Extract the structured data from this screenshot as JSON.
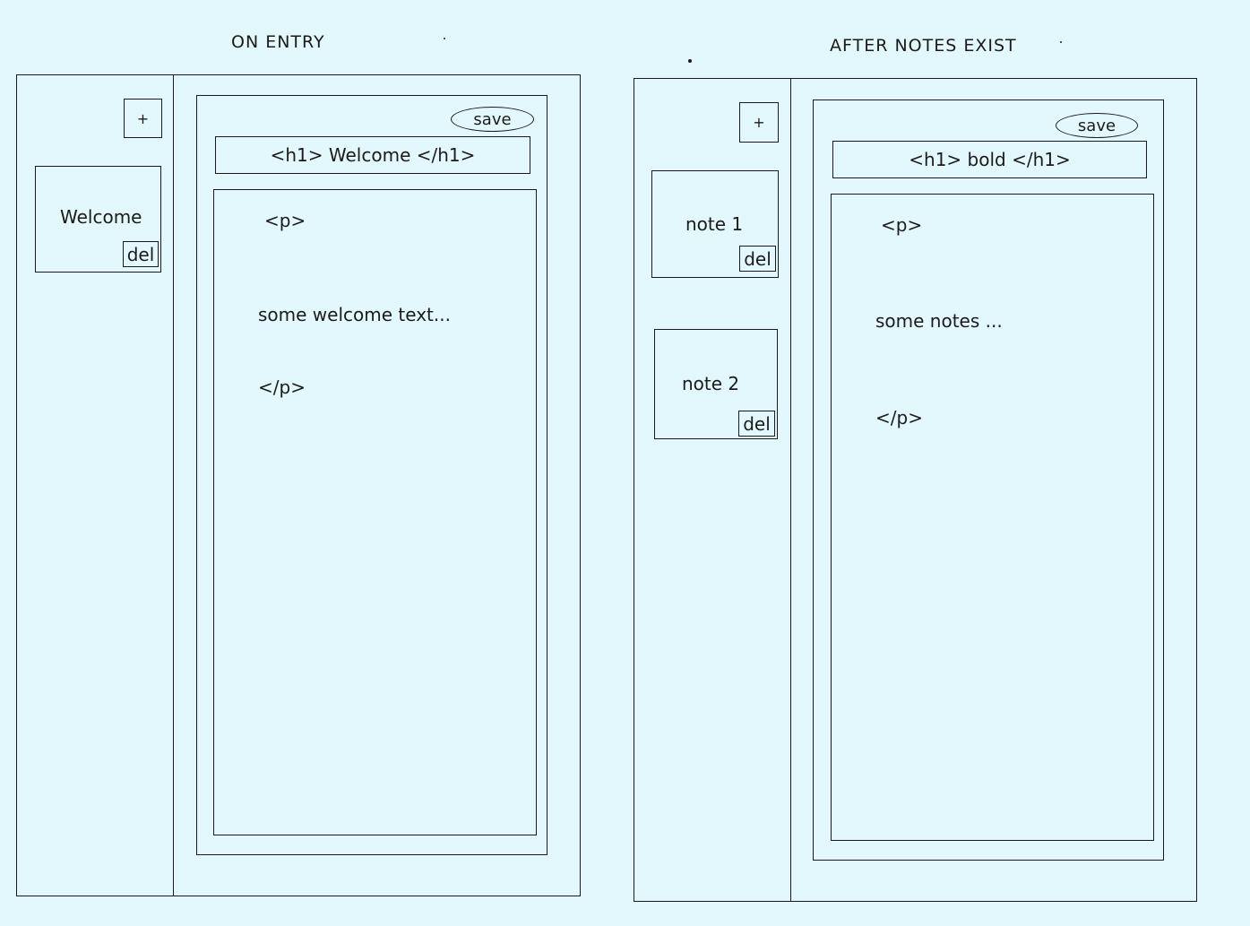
{
  "left": {
    "caption": "ON ENTRY",
    "add_label": "+",
    "notes": [
      {
        "title": "Welcome",
        "delete_label": "del"
      }
    ],
    "save_label": "save",
    "title_field": "<h1>  Welcome </h1>",
    "body_open": "<p>",
    "body_text": "some welcome text...",
    "body_close": "</p>"
  },
  "right": {
    "caption": "AFTER NOTES EXIST",
    "add_label": "+",
    "notes": [
      {
        "title": "note 1",
        "delete_label": "del"
      },
      {
        "title": "note 2",
        "delete_label": "del"
      }
    ],
    "save_label": "save",
    "title_field": "<h1>  bold  </h1>",
    "body_open": "<p>",
    "body_text": "some notes ...",
    "body_close": "</p>"
  }
}
